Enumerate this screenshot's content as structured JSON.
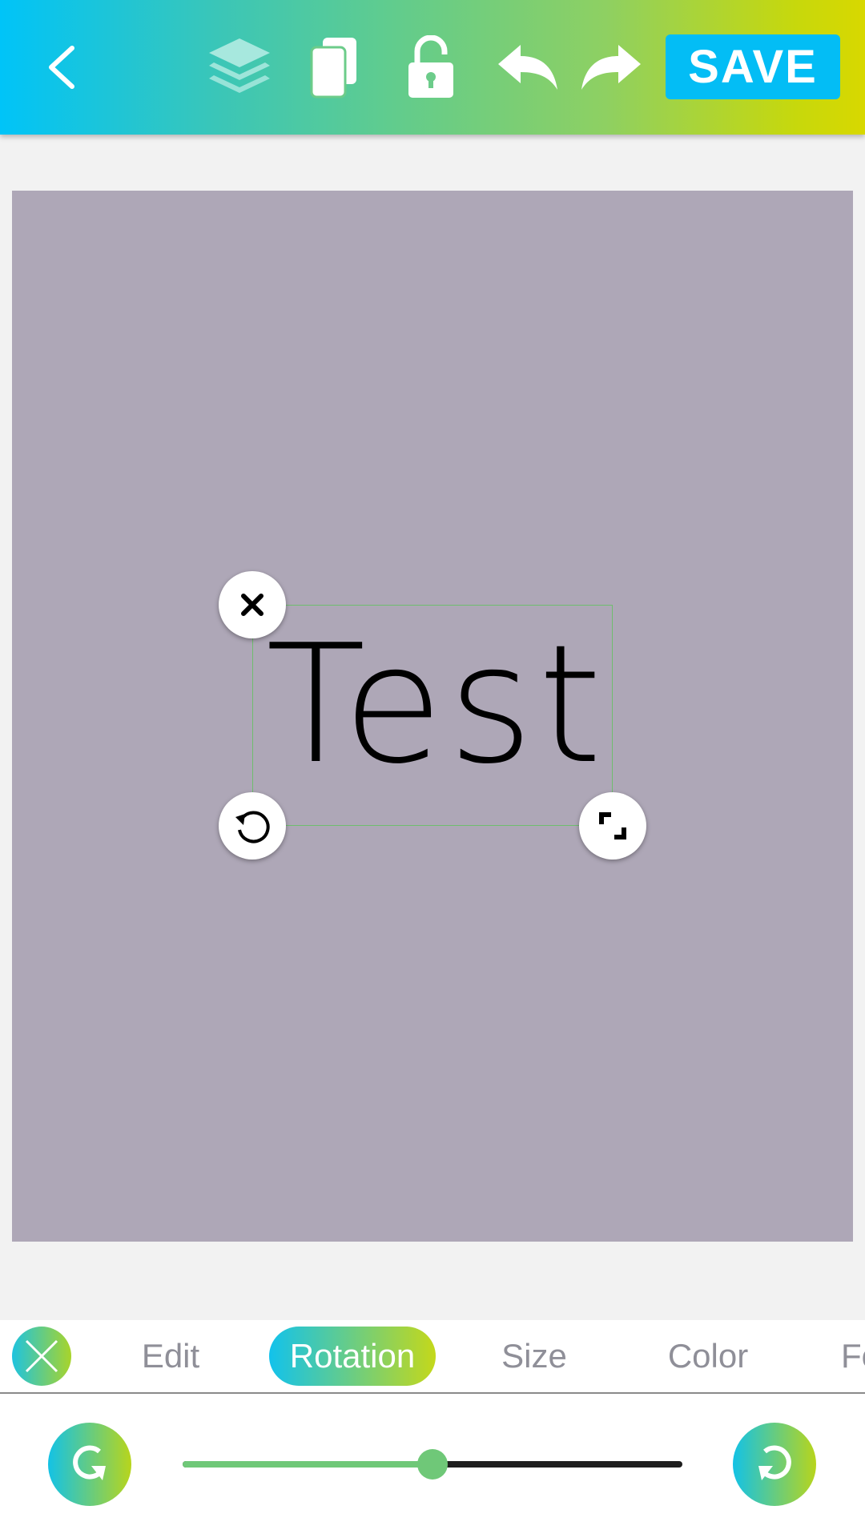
{
  "toolbar": {
    "back_icon": "chevron-left-icon",
    "layers_icon": "layers-icon",
    "duplicate_icon": "copy-icon",
    "lock_icon": "unlock-icon",
    "undo_icon": "undo-icon",
    "redo_icon": "redo-icon",
    "save_label": "SAVE",
    "gradient_start": "#00c4f8",
    "gradient_end": "#d8d800"
  },
  "canvas": {
    "background": "#aea7b7",
    "text_element": {
      "text": "Test",
      "color": "#000000",
      "delete_icon": "close-icon",
      "rotate_icon": "rotate-icon",
      "resize_icon": "resize-icon"
    }
  },
  "tabs": {
    "close_icon": "close-icon",
    "items": [
      {
        "label": "Edit",
        "active": false
      },
      {
        "label": "Rotation",
        "active": true
      },
      {
        "label": "Size",
        "active": false
      },
      {
        "label": "Color",
        "active": false
      },
      {
        "label": "Fo",
        "active": false
      }
    ]
  },
  "rotation": {
    "rotate_left_icon": "rotate-counterclockwise-icon",
    "rotate_right_icon": "rotate-clockwise-icon",
    "slider_value": 0.5
  }
}
